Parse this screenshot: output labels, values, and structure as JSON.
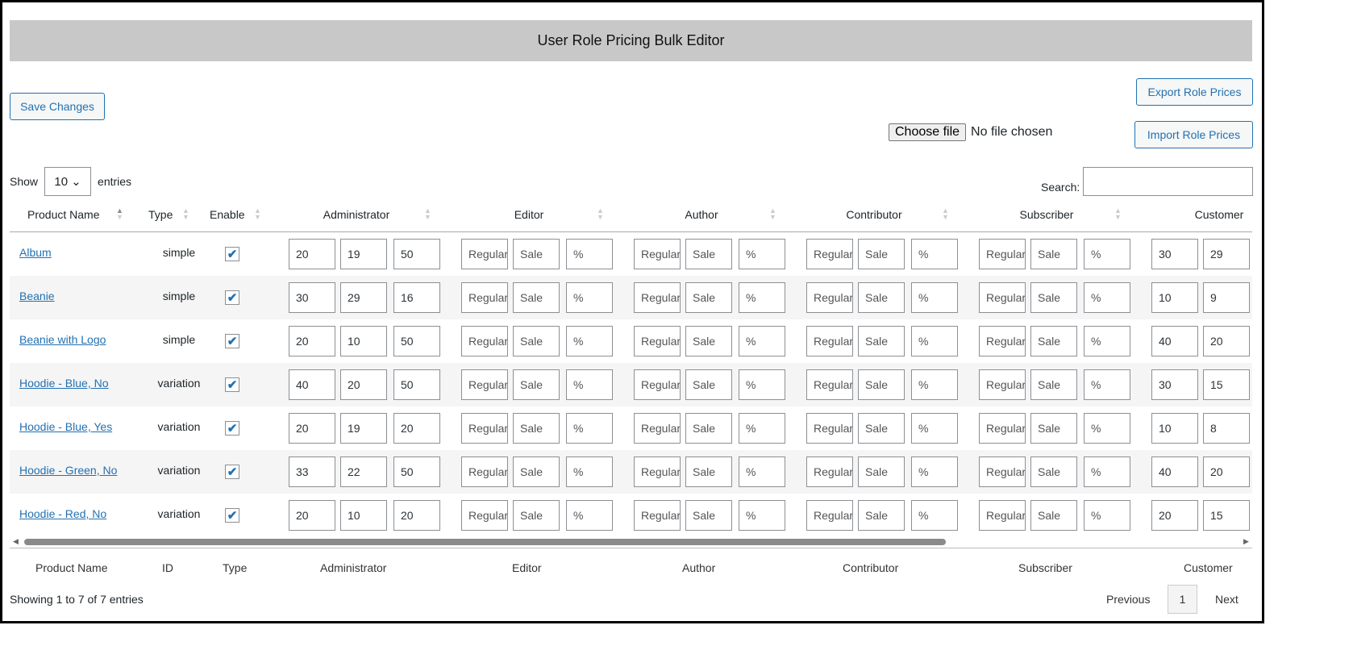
{
  "title": "User Role Pricing Bulk Editor",
  "save_label": "Save Changes",
  "export_label": "Export Role Prices",
  "import_label": "Import Role Prices",
  "file_button": "Choose file",
  "file_status": "No file chosen",
  "show_label": "Show",
  "page_length": "10",
  "entries_label": "entries",
  "search_label": "Search:",
  "columns": [
    "Product Name",
    "Type",
    "Enable"
  ],
  "roles": [
    "Administrator",
    "Editor",
    "Author",
    "Contributor",
    "Subscriber",
    "Customer"
  ],
  "placeholders": [
    "Regular",
    "Sale",
    "%"
  ],
  "rows": [
    {
      "name": "Album",
      "type": "simple",
      "enabled": true,
      "admin": [
        "20",
        "19",
        "50"
      ],
      "customer": [
        "30",
        "29"
      ]
    },
    {
      "name": "Beanie",
      "type": "simple",
      "enabled": true,
      "admin": [
        "30",
        "29",
        "16"
      ],
      "customer": [
        "10",
        "9"
      ]
    },
    {
      "name": "Beanie with Logo",
      "type": "simple",
      "enabled": true,
      "admin": [
        "20",
        "10",
        "50"
      ],
      "customer": [
        "40",
        "20"
      ]
    },
    {
      "name": "Hoodie - Blue, No",
      "type": "variation",
      "enabled": true,
      "admin": [
        "40",
        "20",
        "50"
      ],
      "customer": [
        "30",
        "15"
      ]
    },
    {
      "name": "Hoodie - Blue, Yes",
      "type": "variation",
      "enabled": true,
      "admin": [
        "20",
        "19",
        "20"
      ],
      "customer": [
        "10",
        "8"
      ]
    },
    {
      "name": "Hoodie - Green, No",
      "type": "variation",
      "enabled": true,
      "admin": [
        "33",
        "22",
        "50"
      ],
      "customer": [
        "40",
        "20"
      ]
    },
    {
      "name": "Hoodie - Red, No",
      "type": "variation",
      "enabled": true,
      "admin": [
        "20",
        "10",
        "20"
      ],
      "customer": [
        "20",
        "15"
      ]
    }
  ],
  "footer_columns": [
    "Product Name",
    "ID",
    "Type",
    "Administrator",
    "Editor",
    "Author",
    "Contributor",
    "Subscriber",
    "Customer"
  ],
  "info": "Showing 1 to 7 of 7 entries",
  "pagination": {
    "previous": "Previous",
    "current": "1",
    "next": "Next"
  }
}
